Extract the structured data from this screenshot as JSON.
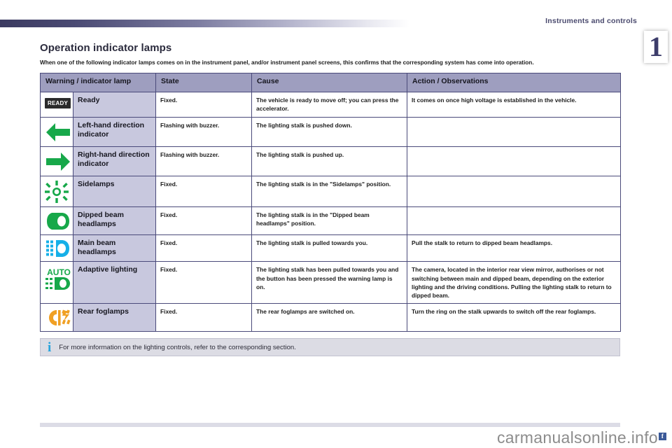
{
  "header": {
    "section_title": "Instruments and controls",
    "chapter_number": "1"
  },
  "page": {
    "title": "Operation indicator lamps",
    "intro": "When one of the following indicator lamps comes on in the instrument panel, and/or instrument panel screens, this confirms that the corresponding system has come into operation."
  },
  "table": {
    "columns": [
      "Warning / indicator lamp",
      "State",
      "Cause",
      "Action / Observations"
    ],
    "rows": [
      {
        "icon": "ready-badge-icon",
        "icon_label": "READY",
        "name": "Ready",
        "state": "Fixed.",
        "cause": "The vehicle is ready to move off; you can press the accelerator.",
        "action": "It comes on once high voltage is established in the vehicle."
      },
      {
        "icon": "left-arrow-indicator-icon",
        "icon_label": "",
        "name": "Left-hand direction indicator",
        "state": "Flashing with buzzer.",
        "cause": "The lighting stalk is pushed down.",
        "action": ""
      },
      {
        "icon": "right-arrow-indicator-icon",
        "icon_label": "",
        "name": "Right-hand direction indicator",
        "state": "Flashing with buzzer.",
        "cause": "The lighting stalk is pushed up.",
        "action": ""
      },
      {
        "icon": "sidelamps-icon",
        "icon_label": "",
        "name": "Sidelamps",
        "state": "Fixed.",
        "cause": "The lighting stalk is in the \"Sidelamps\" position.",
        "action": ""
      },
      {
        "icon": "dipped-beam-headlamps-icon",
        "icon_label": "",
        "name": "Dipped beam headlamps",
        "state": "Fixed.",
        "cause": "The lighting stalk is in the \"Dipped beam headlamps\" position.",
        "action": ""
      },
      {
        "icon": "main-beam-headlamps-icon",
        "icon_label": "",
        "name": "Main beam headlamps",
        "state": "Fixed.",
        "cause": "The lighting stalk is pulled towards you.",
        "action": "Pull the stalk to return to dipped beam headlamps."
      },
      {
        "icon": "adaptive-lighting-icon",
        "icon_label": "AUTO",
        "name": "Adaptive lighting",
        "state": "Fixed.",
        "cause": "The lighting stalk has been pulled towards you and the button has been pressed the warning lamp is on.",
        "action": "The camera, located in the interior rear view mirror, authorises or not switching between main and dipped beam, depending on the exterior lighting and the driving conditions. Pulling the lighting stalk to return to dipped beam."
      },
      {
        "icon": "rear-foglamps-icon",
        "icon_label": "",
        "name": "Rear foglamps",
        "state": "Fixed.",
        "cause": "The rear foglamps are switched on.",
        "action": "Turn the ring on the stalk upwards to switch off the rear foglamps."
      }
    ]
  },
  "note": {
    "icon": "info-icon",
    "glyph": "i",
    "text": "For more information on the lighting controls, refer to the corresponding section."
  },
  "watermark": {
    "text": "carmanualsonline.info",
    "badge": "f"
  },
  "colors": {
    "header_accent": "#3b3a60",
    "table_header_bg": "#9e9ebf",
    "name_cell_bg": "#c8c8de",
    "border": "#4a4a7a",
    "green_indicator": "#17a84a",
    "blue_main_beam": "#16b0e8",
    "amber_foglamp": "#f0a024",
    "info_blue": "#29a3dc",
    "note_bg": "#dcdce4"
  }
}
